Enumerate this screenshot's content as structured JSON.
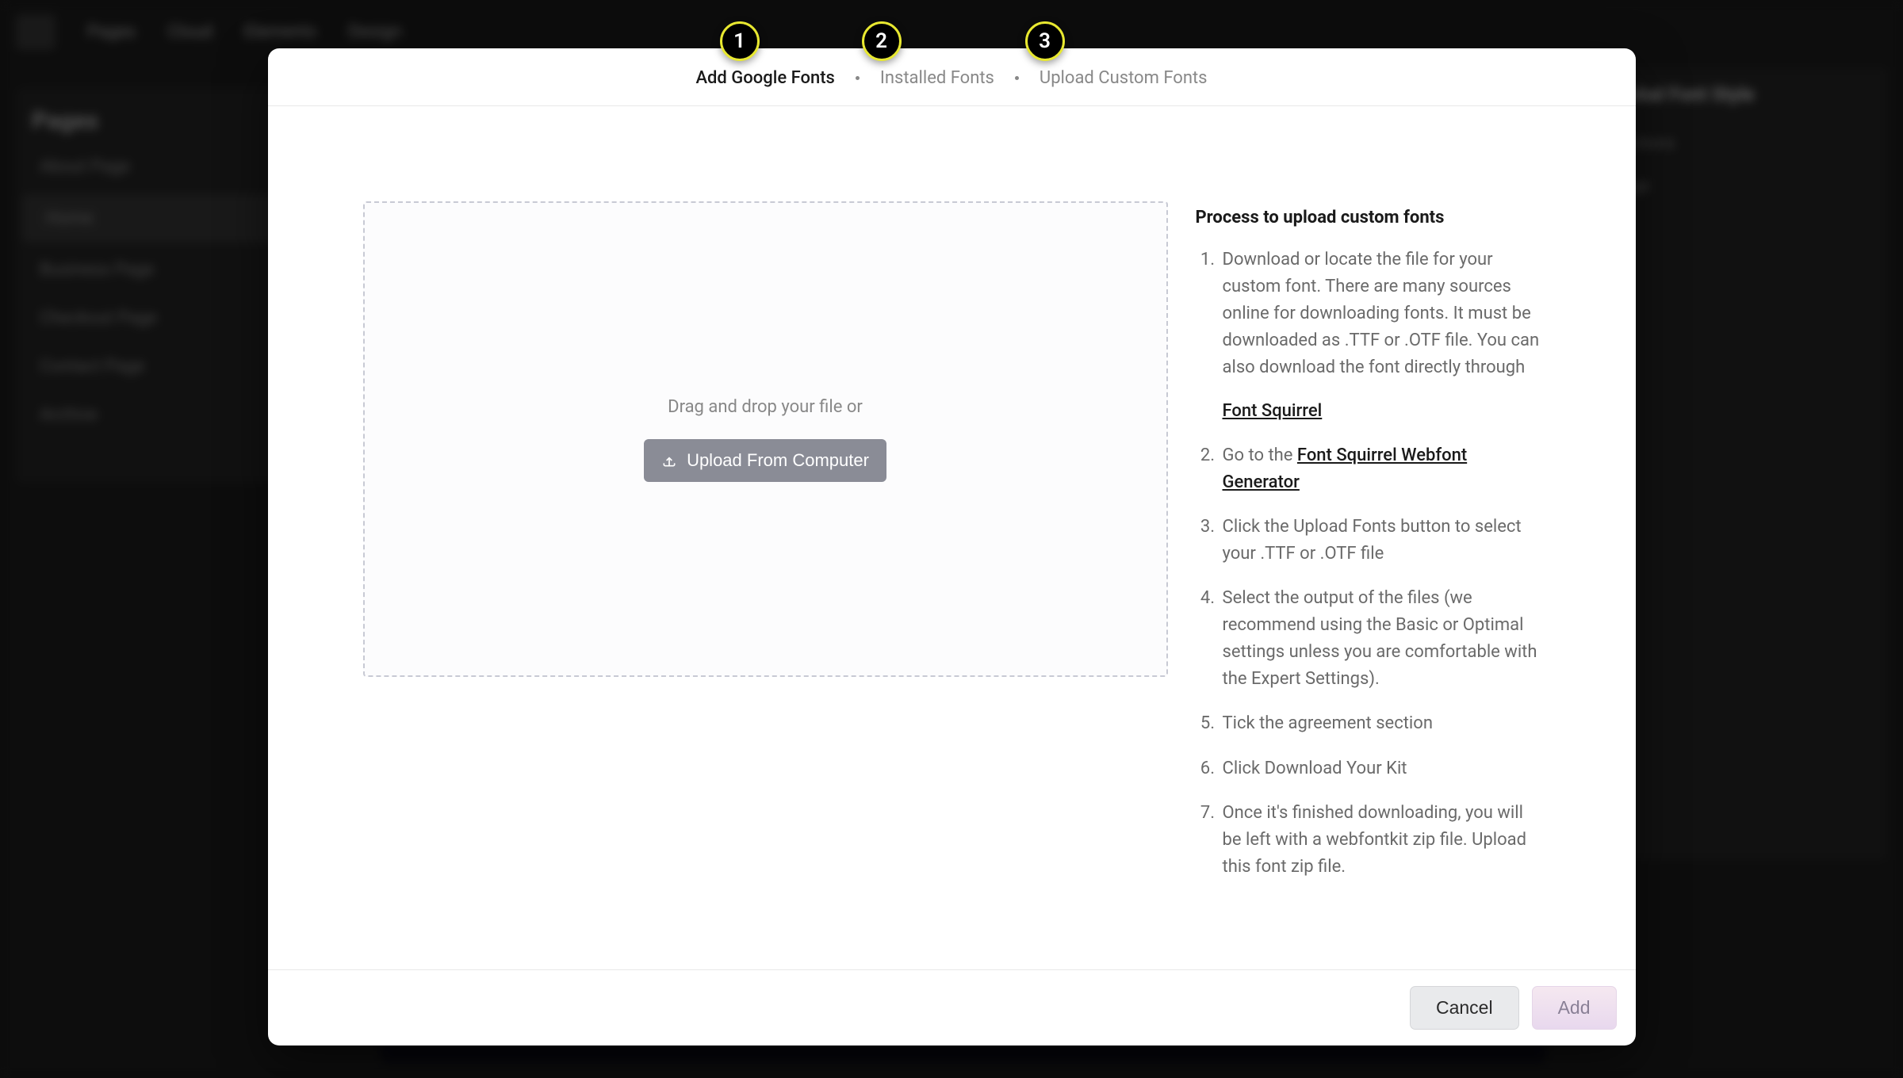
{
  "background": {
    "sidebar": {
      "title": "Pages",
      "items": [
        "About Page",
        "Home",
        "Business Page",
        "Checkout Page",
        "Contact Page",
        "Archive"
      ]
    },
    "topnav": [
      "Pages",
      "Cloud",
      "Elements",
      "Design"
    ],
    "rightPanel": {
      "title": "Global Font Style"
    }
  },
  "annotations": {
    "badge1": "1",
    "badge2": "2",
    "badge3": "3"
  },
  "modal": {
    "tabs": {
      "tab1": "Add Google Fonts",
      "tab2": "Installed Fonts",
      "tab3": "Upload Custom Fonts"
    },
    "dropzone": {
      "text": "Drag and drop your file or",
      "button": "Upload From Computer"
    },
    "instructions": {
      "title": "Process to upload custom fonts",
      "step1": "Download or locate the file for your custom font. There are many sources online for downloading fonts. It must be downloaded as .TTF or .OTF file. You can also download the font directly through",
      "link1": "Font Squirrel",
      "step2pre": "Go to the ",
      "link2": "Font Squirrel Webfont Generator",
      "step3": "Click the Upload Fonts button to select your .TTF or .OTF file",
      "step4": "Select the output of the files (we recommend using the Basic or Optimal settings unless you are comfortable with the Expert Settings).",
      "step5": "Tick the agreement section",
      "step6": "Click Download Your Kit",
      "step7": "Once it's finished downloading, you will be left with a webfontkit zip file. Upload this font zip file."
    },
    "footer": {
      "cancel": "Cancel",
      "add": "Add"
    }
  }
}
